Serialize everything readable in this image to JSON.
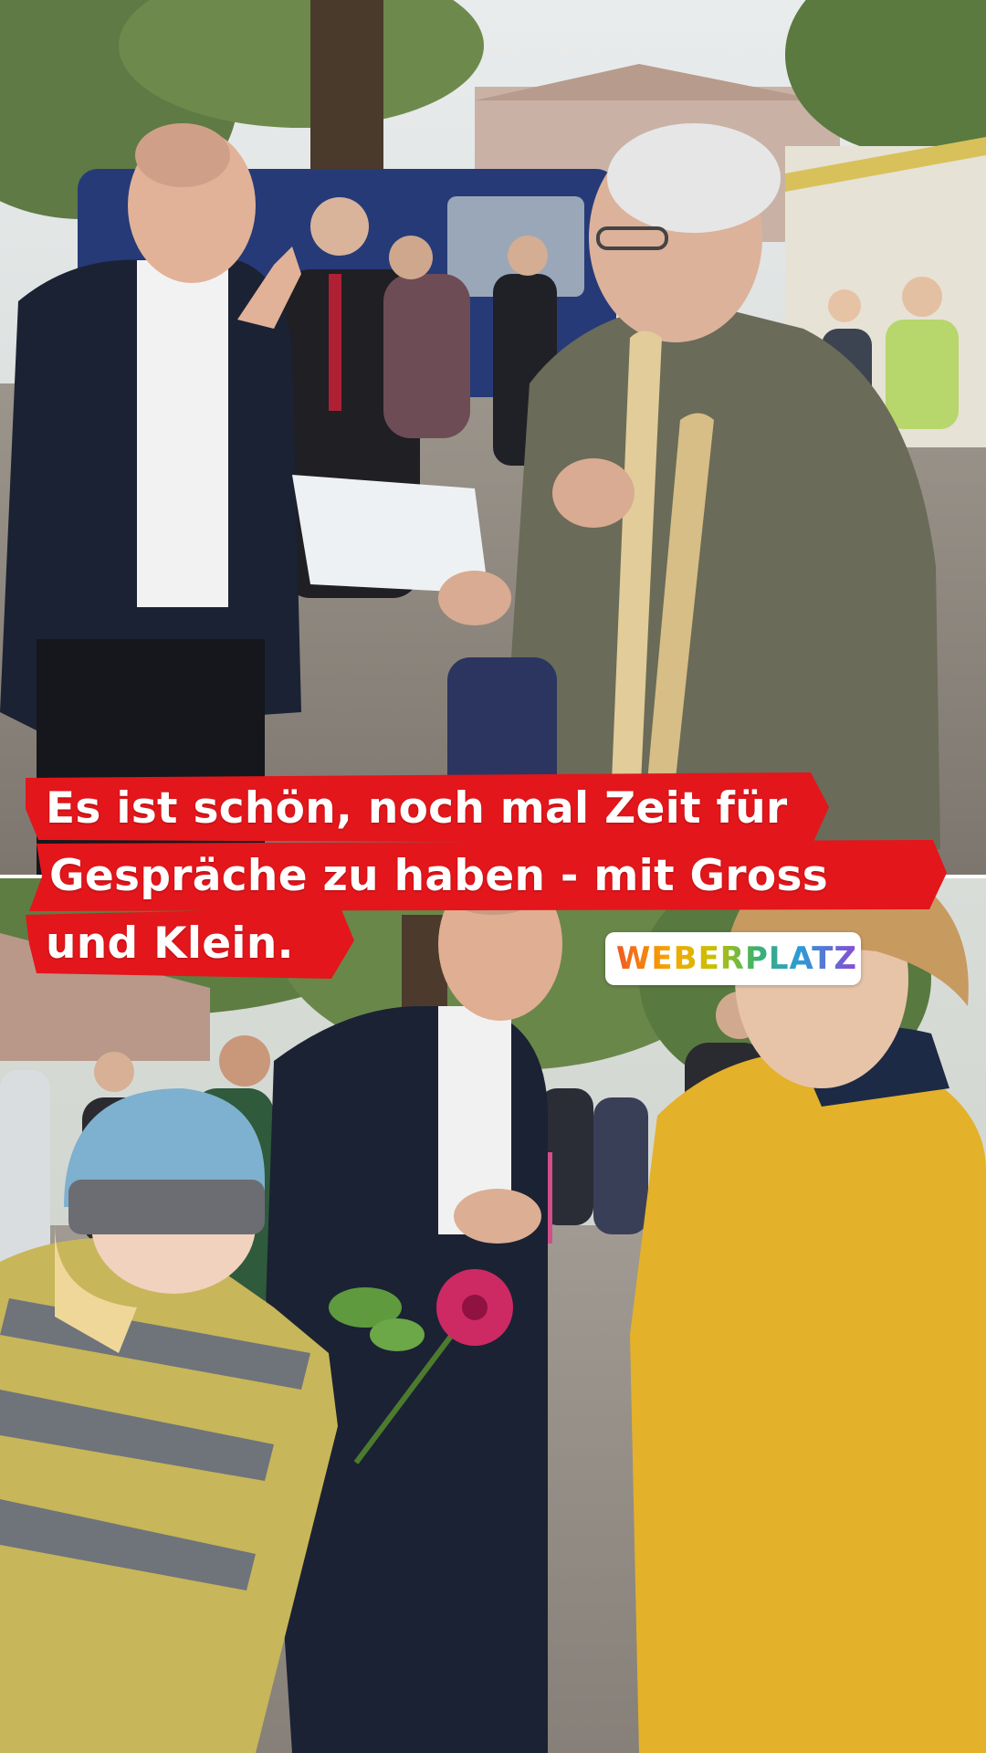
{
  "caption": {
    "line1": "Es ist schön, noch mal Zeit für",
    "line2": "Gespräche zu haben - mit Gross",
    "line3": "und Klein."
  },
  "location_sticker": {
    "icon": "location-pin-icon",
    "label": "WEBERPLATZ"
  },
  "colors": {
    "caption_background": "#e3161b",
    "caption_text": "#ffffff"
  }
}
